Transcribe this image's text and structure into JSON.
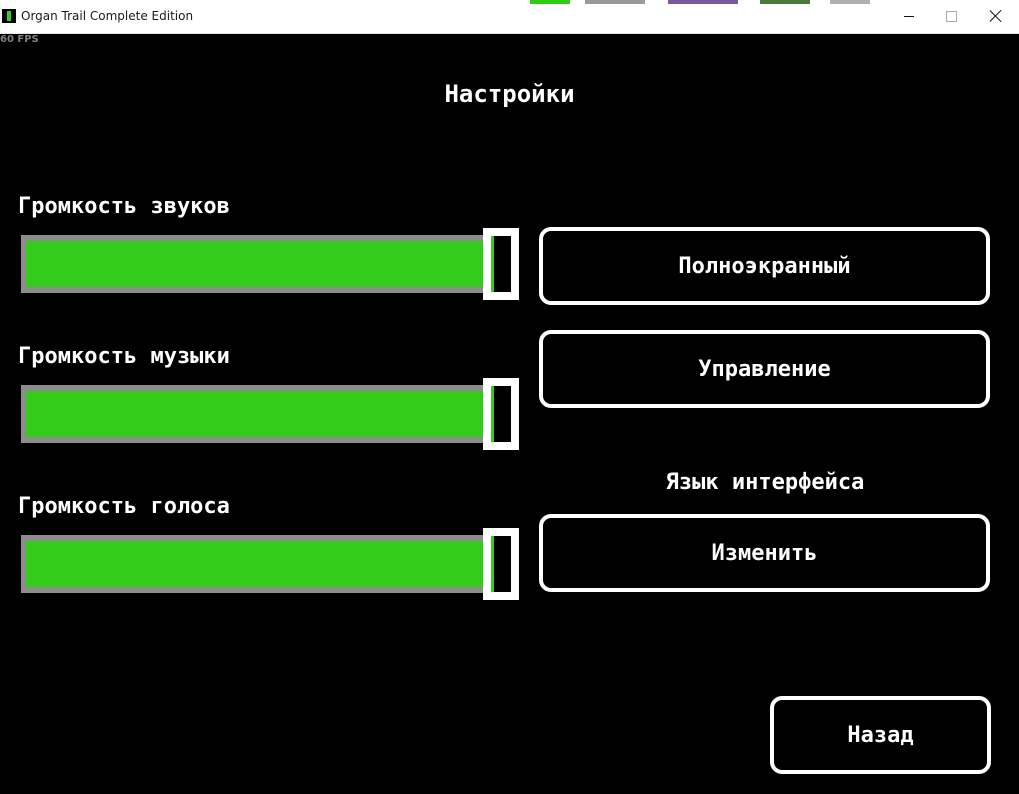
{
  "window": {
    "title": "Organ Trail Complete Edition",
    "minimize_icon": "minimize-icon",
    "maximize_icon": "maximize-icon",
    "close_icon": "close-icon"
  },
  "overlay": {
    "fps": "60 FPS"
  },
  "settings": {
    "heading": "Настройки",
    "sliders": [
      {
        "label": "Громкость звуков",
        "value_fraction": 0.96
      },
      {
        "label": "Громкость музыки",
        "value_fraction": 0.96
      },
      {
        "label": "Громкость голоса",
        "value_fraction": 0.96
      }
    ],
    "buttons": {
      "fullscreen": "Полноэкранный",
      "controls": "Управление",
      "change": "Изменить",
      "back": "Назад"
    },
    "section_label": "Язык интерфейса"
  },
  "colors": {
    "background": "#000000",
    "accent_green": "#33cc1a",
    "track_gray": "#8c8c8c",
    "text": "#ffffff"
  }
}
